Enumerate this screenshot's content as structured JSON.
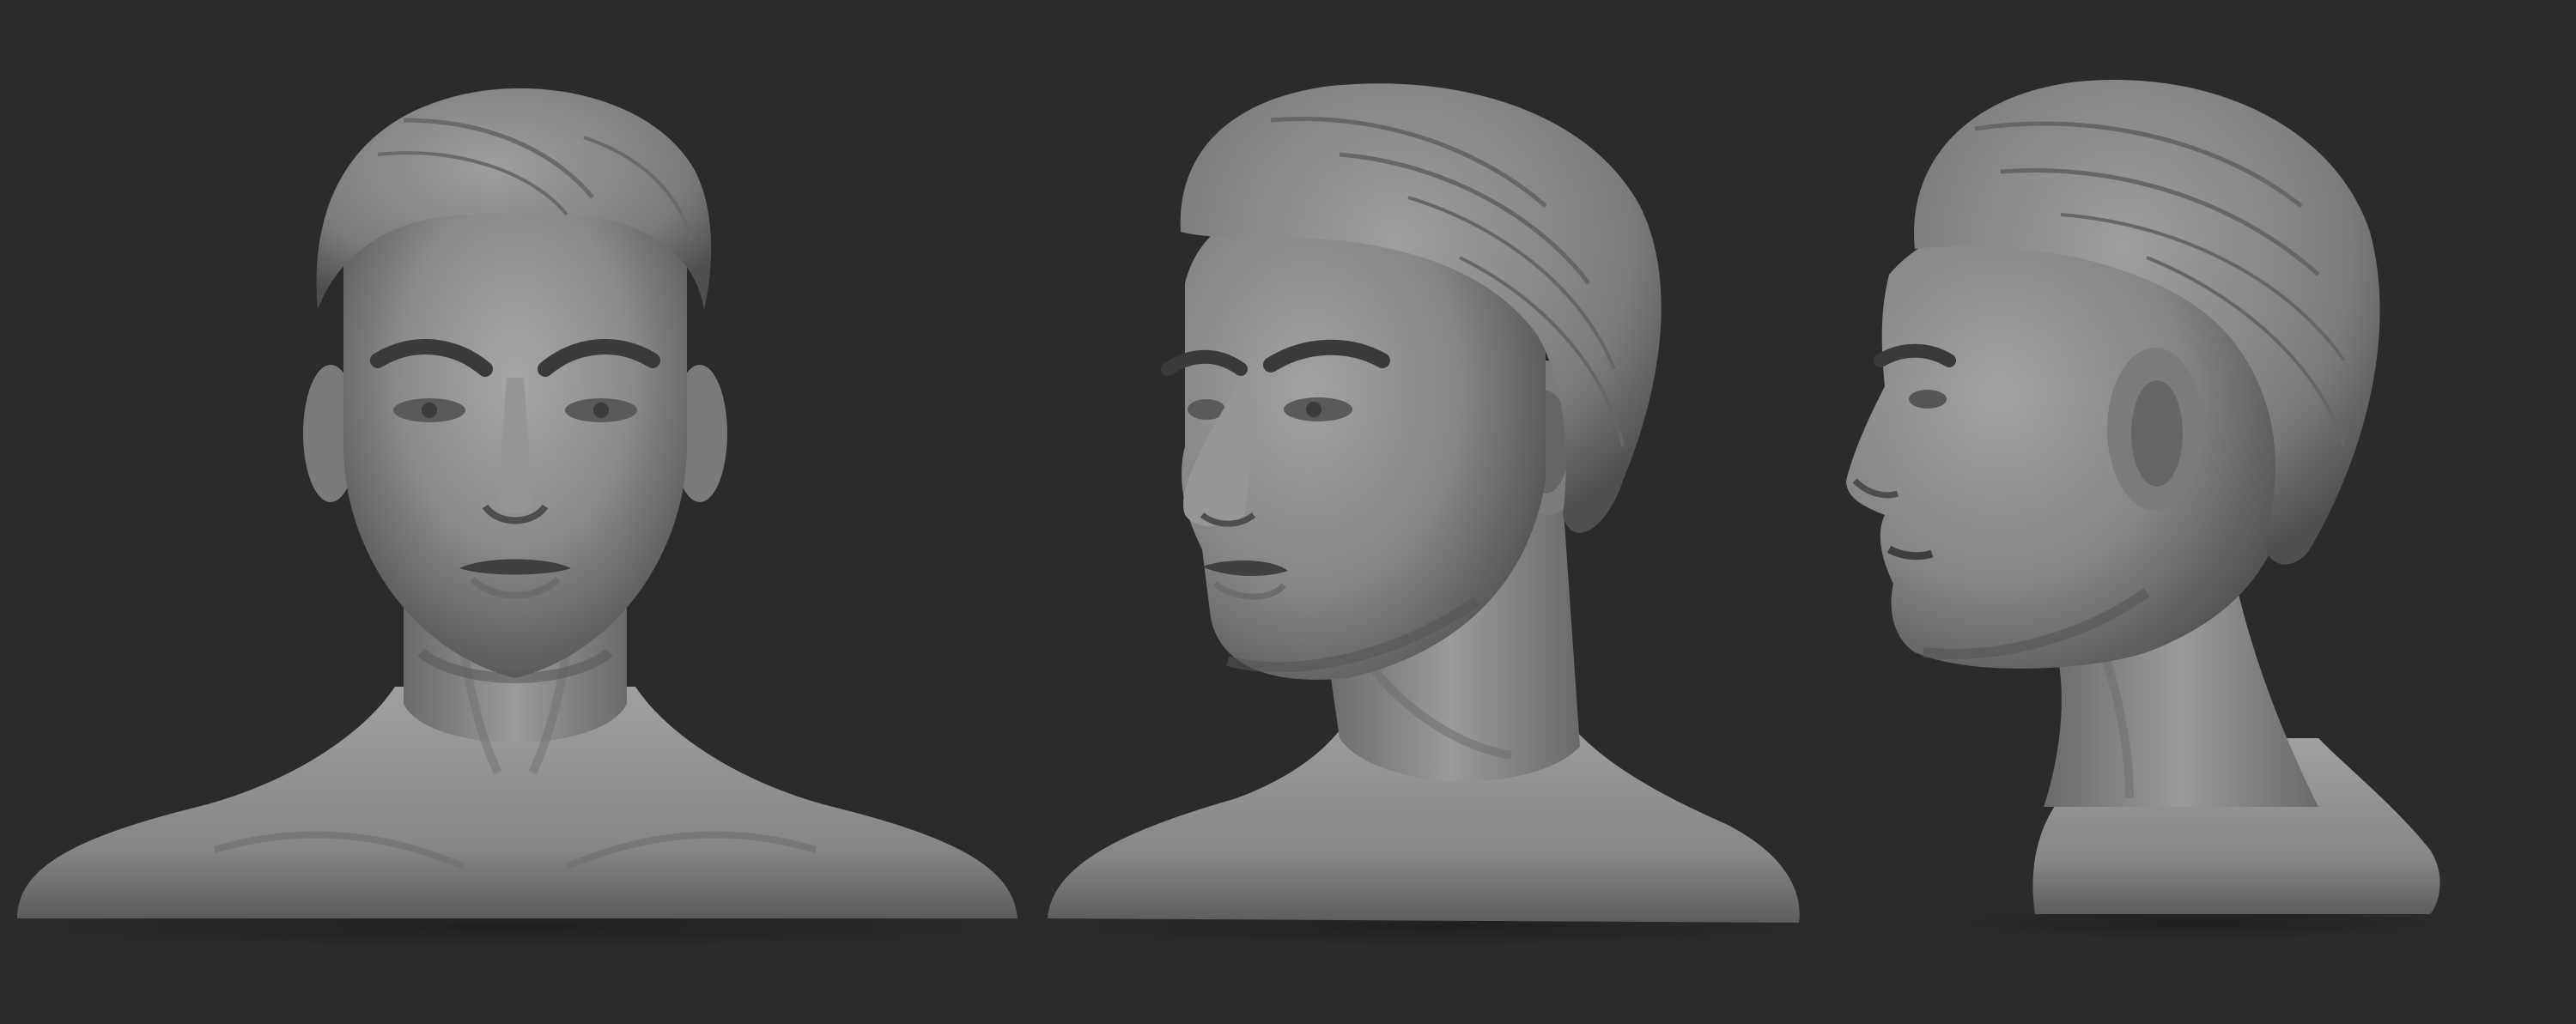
{
  "scene": {
    "background_color": "#2b2b2b",
    "material_color": "#8a8a8a",
    "views": [
      {
        "name": "front",
        "icon": "sculpt-bust-front-view"
      },
      {
        "name": "three-quarter",
        "icon": "sculpt-bust-three-quarter-view"
      },
      {
        "name": "profile",
        "icon": "sculpt-bust-profile-view"
      }
    ]
  }
}
